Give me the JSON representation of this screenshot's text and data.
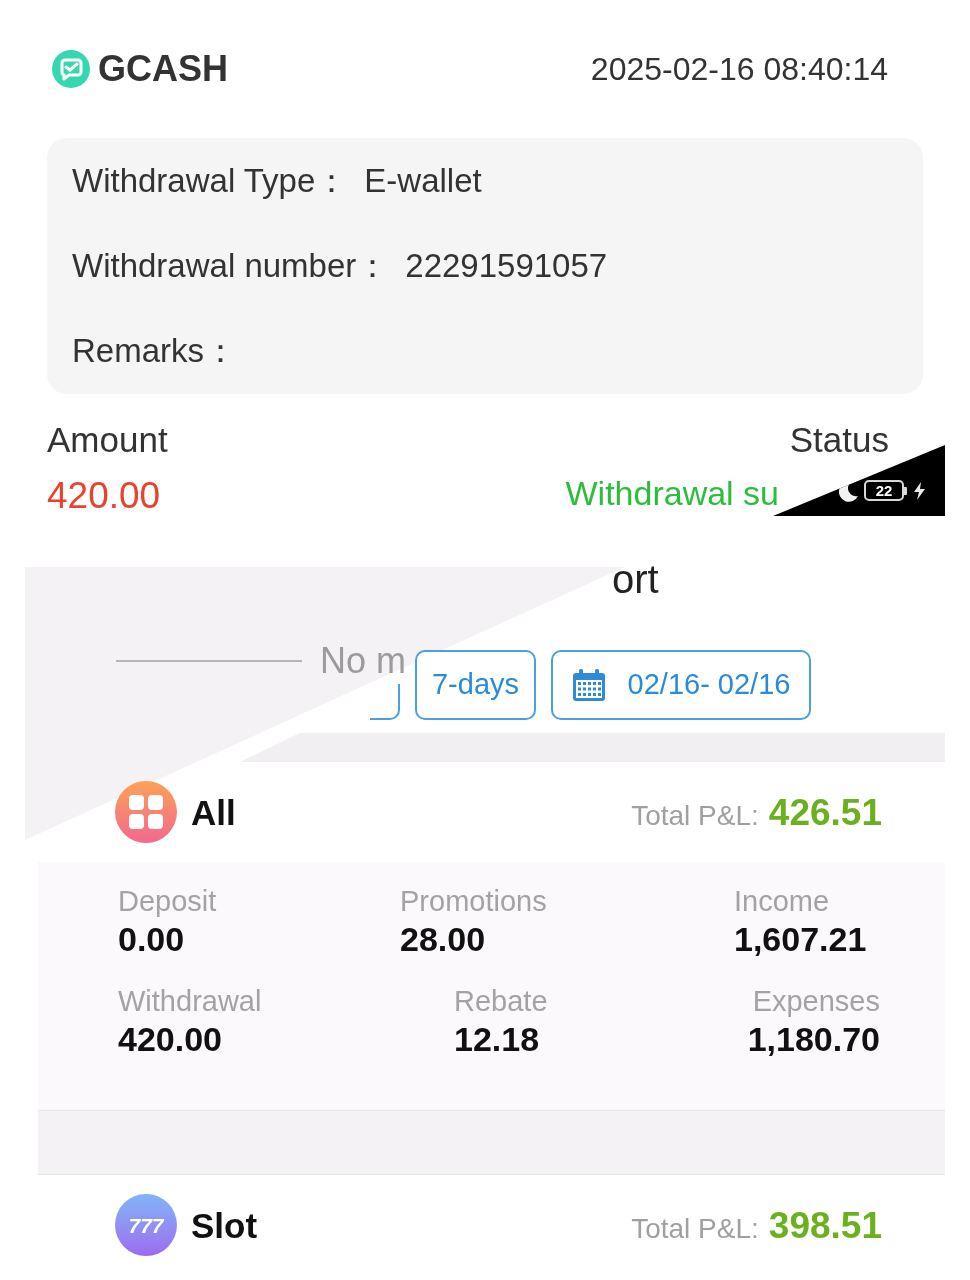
{
  "header": {
    "brand": "GCASH",
    "datetime": "2025-02-16 08:40:14"
  },
  "details": [
    {
      "label": "Withdrawal Type：",
      "value": "E-wallet"
    },
    {
      "label": "Withdrawal number：",
      "value": "22291591057"
    },
    {
      "label": "Remarks："
    }
  ],
  "amount": {
    "label": "Amount",
    "value": "420.00"
  },
  "status": {
    "label": "Status",
    "value": "Withdrawal su"
  },
  "status_bar": {
    "battery": "22",
    "charging": true,
    "do_not_disturb": true
  },
  "report": {
    "title": "ort",
    "divider_text": "No m",
    "filters": [
      {
        "kind": "partial"
      },
      {
        "kind": "preset",
        "label": "7-days"
      },
      {
        "kind": "date_range",
        "label": "02/16- 02/16"
      }
    ]
  },
  "categories": [
    {
      "kind": "all",
      "name": "All",
      "pnl_label": "Total P&L:",
      "pnl_value": "426.51",
      "stats": [
        {
          "label": "Deposit",
          "value": "0.00"
        },
        {
          "label": "Promotions",
          "value": "28.00"
        },
        {
          "label": "Income",
          "value": "1,607.21"
        },
        {
          "label": "Withdrawal",
          "value": "420.00"
        },
        {
          "label": "Rebate",
          "value": "12.18"
        },
        {
          "label": "Expenses",
          "value": "1,180.70"
        }
      ]
    },
    {
      "kind": "slot",
      "name": "Slot",
      "icon_text": "777",
      "pnl_label": "Total P&L:",
      "pnl_value": "398.51"
    }
  ]
}
